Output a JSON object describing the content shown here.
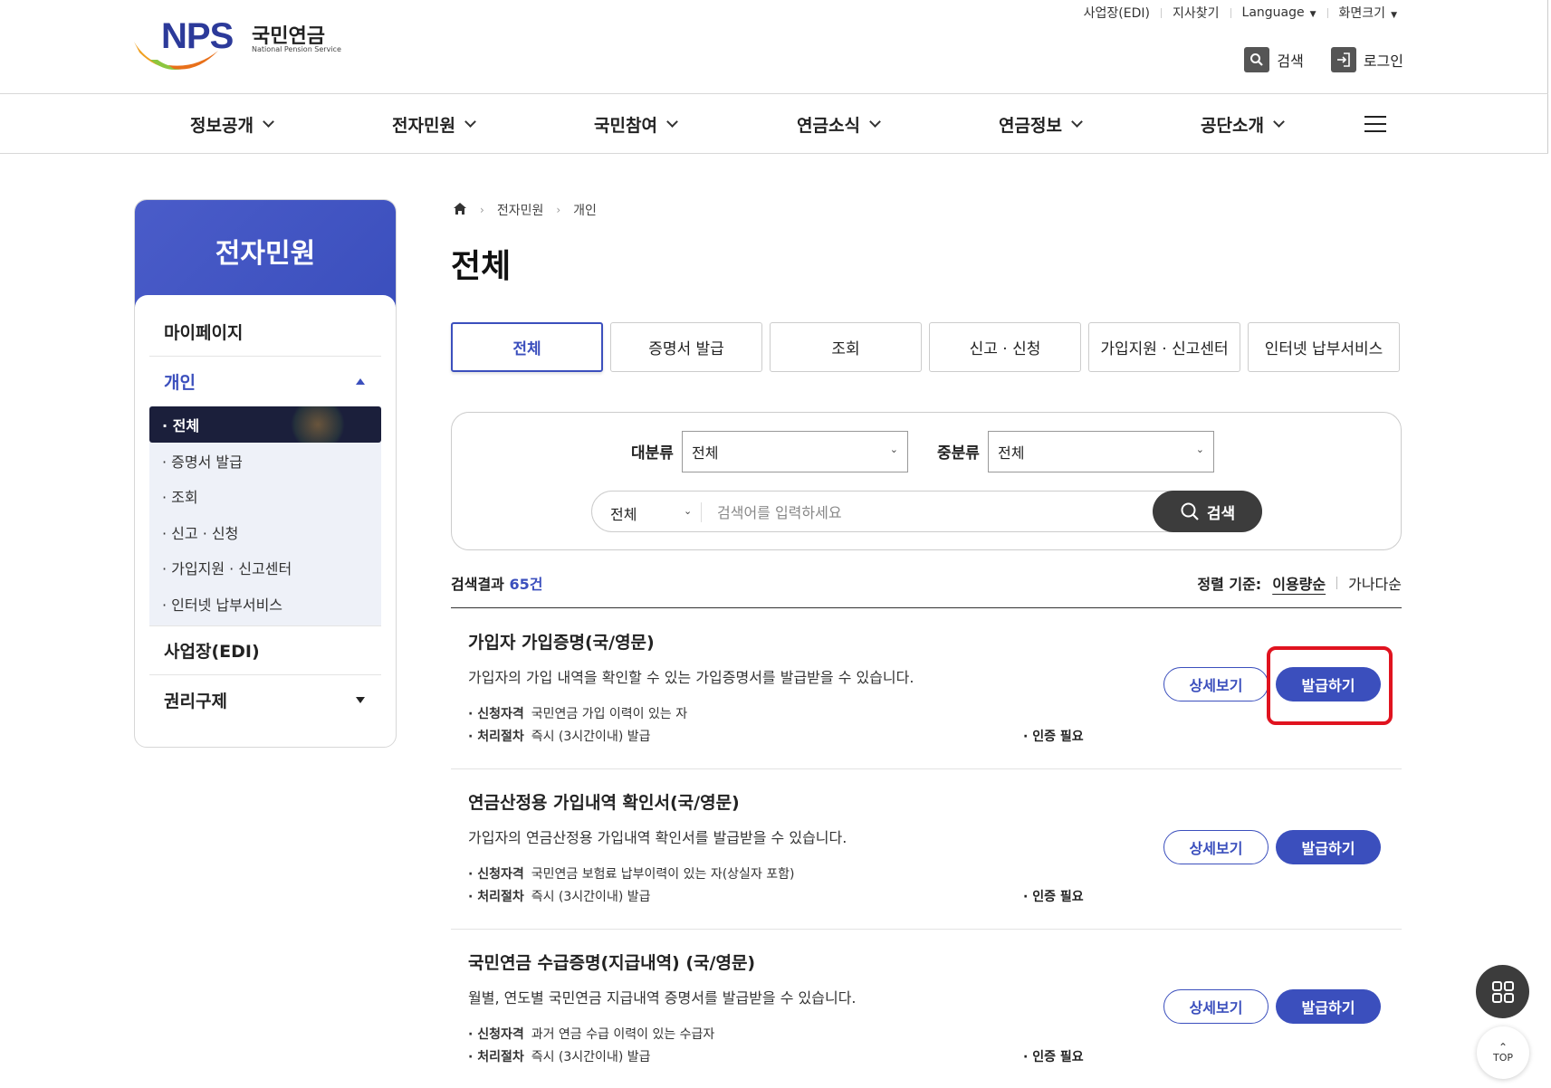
{
  "logo": {
    "mark": "NPS",
    "name_ko": "국민연금",
    "name_en": "National Pension Service"
  },
  "utility": {
    "edi": "사업장(EDI)",
    "branch": "지사찾기",
    "language": "Language",
    "screen_size": "화면크기"
  },
  "header": {
    "search": "검색",
    "login": "로그인"
  },
  "gnb": [
    "정보공개",
    "전자민원",
    "국민참여",
    "연금소식",
    "연금정보",
    "공단소개"
  ],
  "sidebar": {
    "title": "전자민원",
    "items": {
      "mypage": "마이페이지",
      "personal": "개인",
      "edi": "사업장(EDI)",
      "rights": "권리구제"
    },
    "sub_items": [
      "· 전체",
      "· 증명서 발급",
      "· 조회",
      "· 신고 · 신청",
      "· 가입지원 · 신고센터",
      "· 인터넷 납부서비스"
    ]
  },
  "breadcrumb": [
    "전자민원",
    "개인"
  ],
  "page_title": "전체",
  "tabs": [
    "전체",
    "증명서 발급",
    "조회",
    "신고 · 신청",
    "가입지원 · 신고센터",
    "인터넷 납부서비스"
  ],
  "search": {
    "major_label": "대분류",
    "major_value": "전체",
    "middle_label": "중분류",
    "middle_value": "전체",
    "scope_value": "전체",
    "placeholder": "검색어를 입력하세요",
    "button": "검색"
  },
  "results": {
    "label": "검색결과",
    "count": "65건",
    "sort_label": "정렬 기준:",
    "sort_usage": "이용량순",
    "sort_alpha": "가나다순"
  },
  "items": [
    {
      "title": "가입자 가입증명(국/영문)",
      "desc": "가입자의 가입 내역을 확인할 수 있는 가입증명서를 발급받을 수 있습니다.",
      "eligibility_label": "· 신청자격",
      "eligibility": "국민연금 가입 이력이 있는 자",
      "process_label": "· 처리절차",
      "process": "즉시 (3시간이내) 발급",
      "cert": "· 인증 필요",
      "detail_btn": "상세보기",
      "issue_btn": "발급하기"
    },
    {
      "title": "연금산정용 가입내역 확인서(국/영문)",
      "desc": "가입자의 연금산정용 가입내역 확인서를 발급받을 수 있습니다.",
      "eligibility_label": "· 신청자격",
      "eligibility": "국민연금 보험료 납부이력이 있는 자(상실자 포함)",
      "process_label": "· 처리절차",
      "process": "즉시 (3시간이내) 발급",
      "cert": "· 인증 필요",
      "detail_btn": "상세보기",
      "issue_btn": "발급하기"
    },
    {
      "title": "국민연금 수급증명(지급내역) (국/영문)",
      "desc": "월별, 연도별 국민연금 지급내역 증명서를 발급받을 수 있습니다.",
      "eligibility_label": "· 신청자격",
      "eligibility": "과거 연금 수급 이력이 있는 수급자",
      "process_label": "· 처리절차",
      "process": "즉시 (3시간이내) 발급",
      "cert": "· 인증 필요",
      "detail_btn": "상세보기",
      "issue_btn": "발급하기"
    }
  ],
  "float": {
    "top_label": "TOP"
  },
  "colors": {
    "brand": "#3b4fbd",
    "highlight": "#e0131f",
    "dark": "#1b1f3b"
  }
}
